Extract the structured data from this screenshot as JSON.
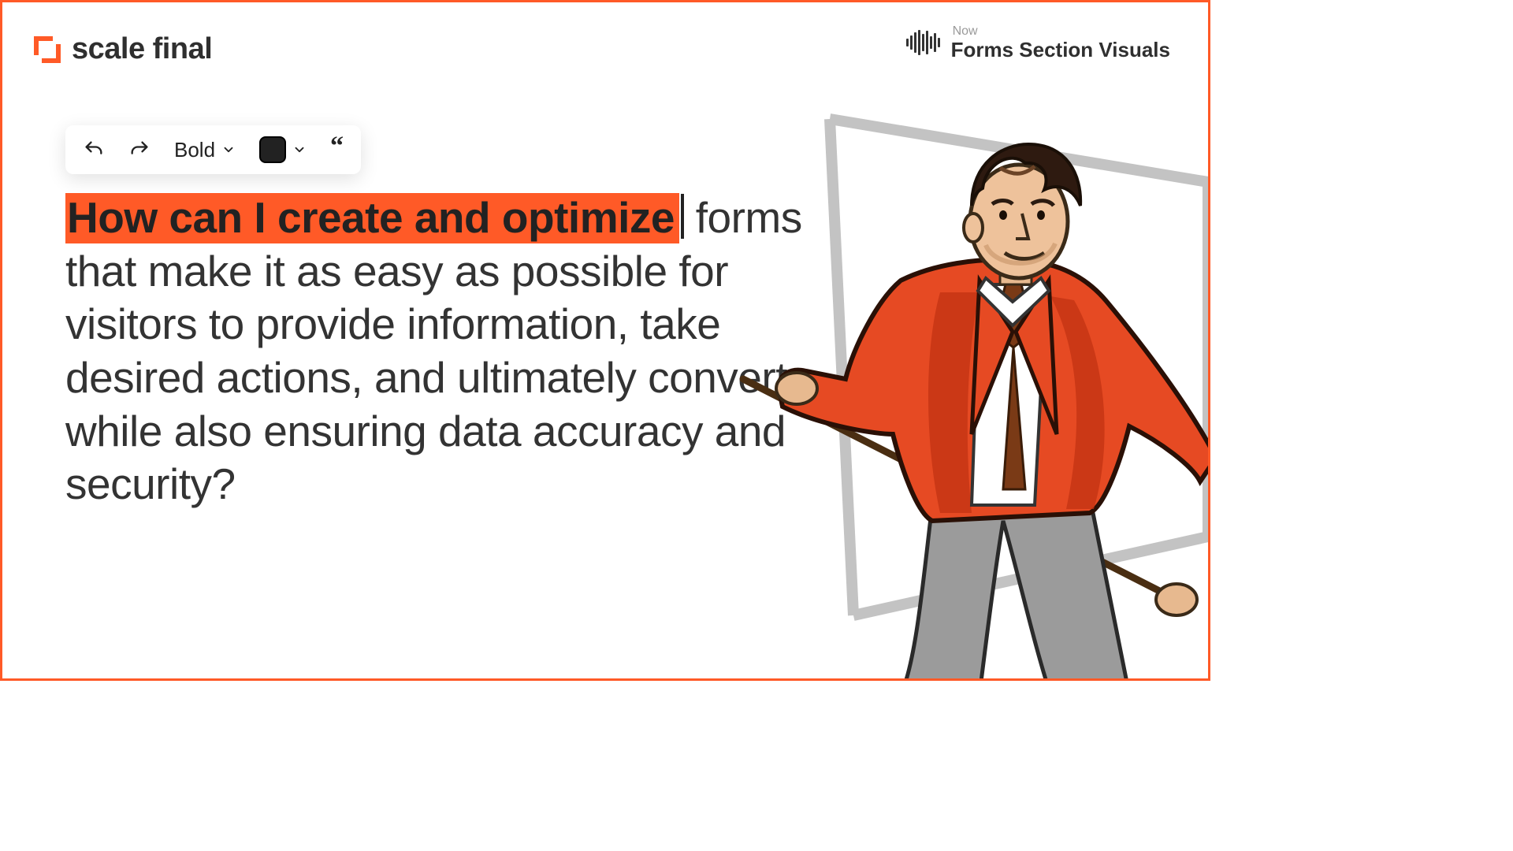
{
  "brand": {
    "name": "scale final"
  },
  "header": {
    "now_label": "Now",
    "now_title": "Forms Section Visuals"
  },
  "toolbar": {
    "bold_label": "Bold",
    "color_swatch": "#222222"
  },
  "content": {
    "highlighted": "How can I create and optimize",
    "rest": " forms that make it as easy as possible for visitors to provide information, take desired actions, and ultimately convert, while also ensuring data accuracy and security?"
  },
  "colors": {
    "accent": "#ff5a27",
    "highlight": "#ff5a27"
  }
}
